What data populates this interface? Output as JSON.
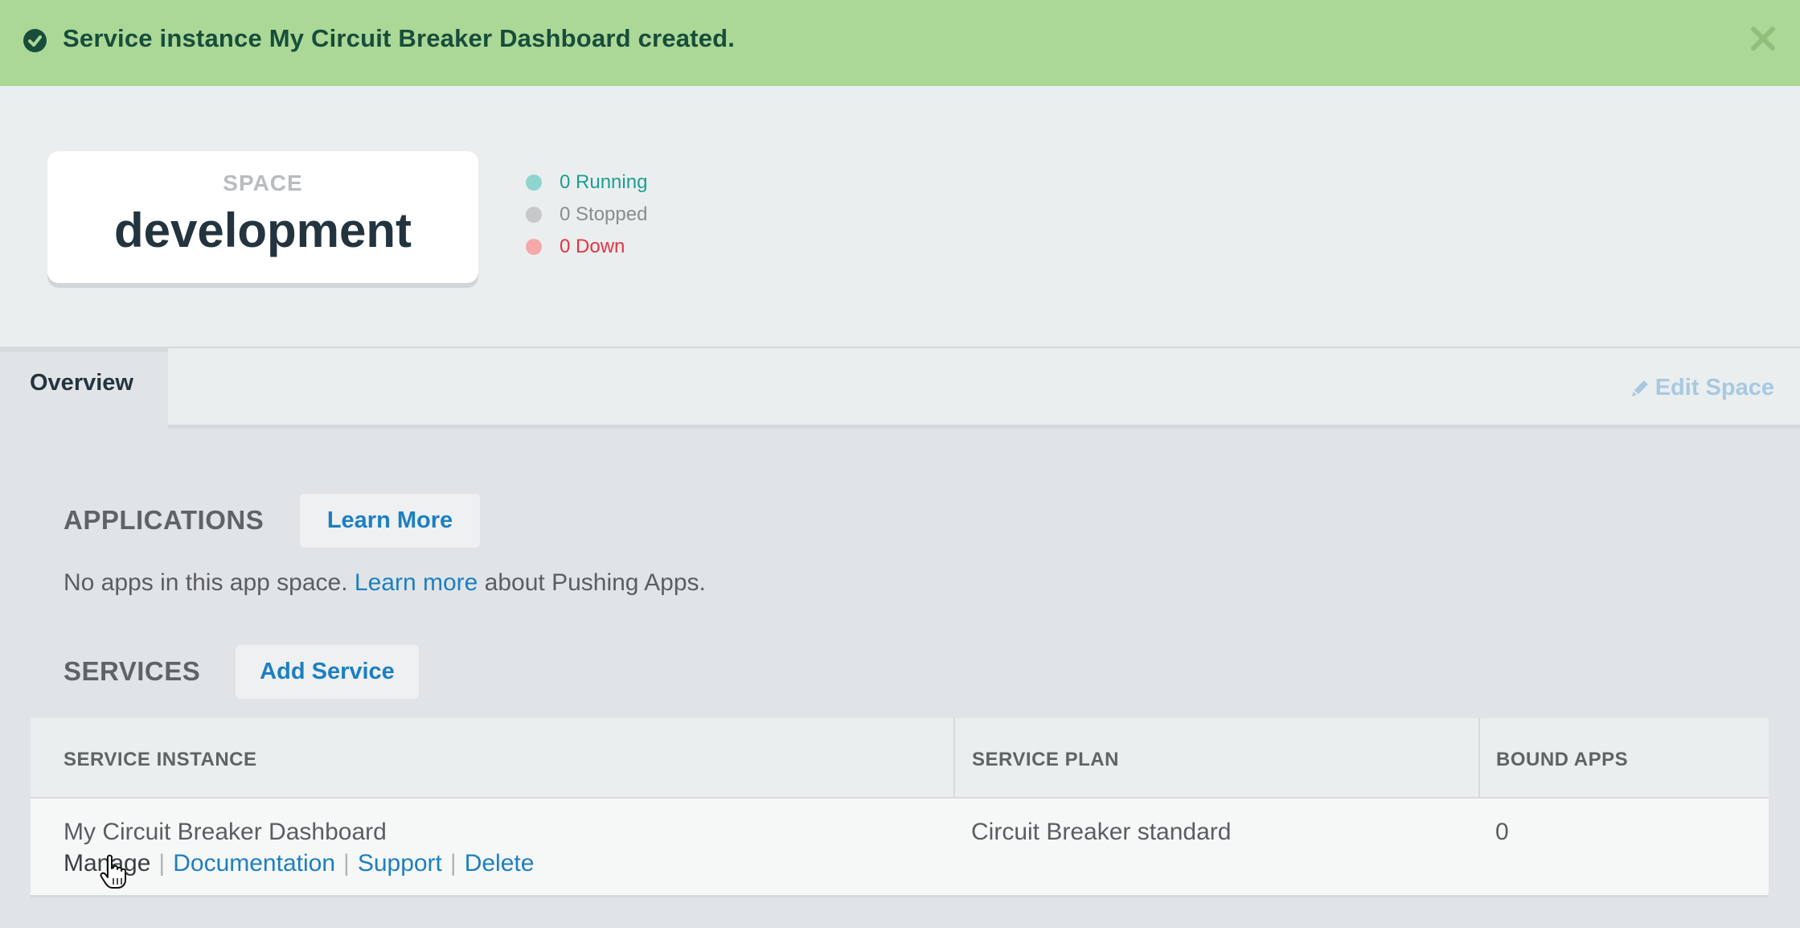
{
  "banner": {
    "message": "Service instance My Circuit Breaker Dashboard created."
  },
  "space": {
    "label": "SPACE",
    "name": "development"
  },
  "status": {
    "running": "0 Running",
    "stopped": "0 Stopped",
    "down": "0 Down"
  },
  "tabs": {
    "overview": "Overview",
    "edit_space": "Edit Space"
  },
  "applications": {
    "title": "APPLICATIONS",
    "learn_more_button": "Learn More",
    "empty_prefix": "No apps in this app space.",
    "empty_link": "Learn more",
    "empty_suffix": "about Pushing Apps."
  },
  "services": {
    "title": "SERVICES",
    "add_button": "Add Service",
    "columns": [
      "SERVICE INSTANCE",
      "SERVICE PLAN",
      "BOUND APPS"
    ],
    "rows": [
      {
        "instance": "My Circuit Breaker Dashboard",
        "plan": "Circuit Breaker standard",
        "bound_apps": "0",
        "actions": [
          "Manage",
          "Documentation",
          "Support",
          "Delete"
        ]
      }
    ]
  },
  "colors": {
    "banner_bg": "#acd897",
    "banner_text": "#174d3a",
    "link": "#1d7fc0",
    "running": "#1a9f94",
    "down": "#e3333f"
  }
}
